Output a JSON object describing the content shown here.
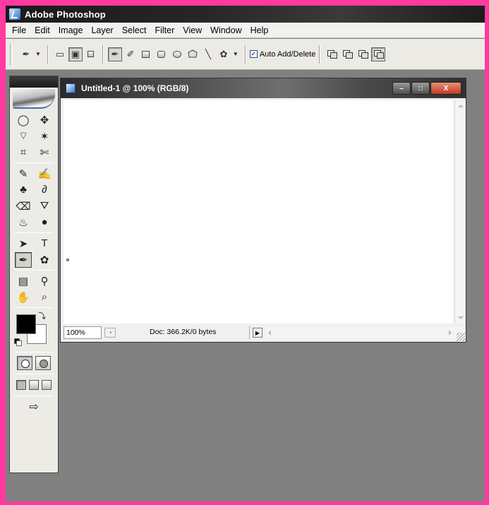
{
  "app": {
    "title": "Adobe Photoshop"
  },
  "menu": [
    "File",
    "Edit",
    "Image",
    "Layer",
    "Select",
    "Filter",
    "View",
    "Window",
    "Help"
  ],
  "options_bar": {
    "tool_icon": "pen-icon",
    "auto_add_delete": {
      "label": "Auto Add/Delete",
      "checked": true,
      "check_glyph": "✓"
    },
    "icons": {
      "caret": "▼",
      "pen": "✒",
      "freeform_pen": "✐",
      "line": "╲",
      "custom_shape": "✿",
      "shape_layers": "▭",
      "paths": "▣"
    }
  },
  "toolbox": {
    "rows": [
      [
        {
          "name": "elliptical-marquee",
          "glyph": "◯"
        },
        {
          "name": "move",
          "glyph": "✥"
        }
      ],
      [
        {
          "name": "polygonal-lasso",
          "glyph": "⌔"
        },
        {
          "name": "magic-wand",
          "glyph": "✶"
        }
      ],
      [
        {
          "name": "crop",
          "glyph": "⌗"
        },
        {
          "name": "slice",
          "glyph": "✄"
        }
      ],
      [
        {
          "name": "healing-brush",
          "glyph": "✎"
        },
        {
          "name": "brush",
          "glyph": "✍"
        }
      ],
      [
        {
          "name": "clone-stamp",
          "glyph": "♣"
        },
        {
          "name": "history-brush",
          "glyph": "∂"
        }
      ],
      [
        {
          "name": "eraser",
          "glyph": "⌫"
        },
        {
          "name": "paint-bucket",
          "glyph": "⛛"
        }
      ],
      [
        {
          "name": "blur",
          "glyph": "♨"
        },
        {
          "name": "burn",
          "glyph": "●"
        }
      ],
      [
        {
          "name": "path-selection",
          "glyph": "➤"
        },
        {
          "name": "type",
          "glyph": "T"
        }
      ],
      [
        {
          "name": "pen",
          "glyph": "✒"
        },
        {
          "name": "custom-shape",
          "glyph": "✿"
        }
      ],
      [
        {
          "name": "notes",
          "glyph": "▤"
        },
        {
          "name": "eyedropper",
          "glyph": "⚲"
        }
      ],
      [
        {
          "name": "hand",
          "glyph": "✋"
        },
        {
          "name": "zoom",
          "glyph": "⌕"
        }
      ]
    ],
    "swap_glyph": "⤵",
    "jump_glyph": "⇨"
  },
  "document": {
    "title": "Untitled-1 @ 100% (RGB/8)",
    "zoom": "100%",
    "doc_size": "Doc: 366.2K/0 bytes",
    "status_nav_glyph": "◔",
    "status_menu_glyph": "▶",
    "window_buttons": {
      "minimize": "–",
      "maximize": "□",
      "close": "X"
    }
  },
  "colors": {
    "foreground": "#000000",
    "background": "#ffffff",
    "border": "#ff3aa0"
  }
}
